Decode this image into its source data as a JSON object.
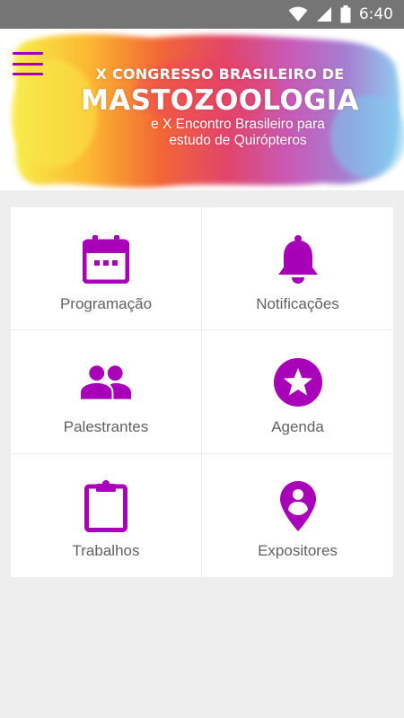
{
  "status_bar": {
    "time": "6:40",
    "icons": [
      "wifi-icon",
      "signal-icon",
      "battery-icon"
    ]
  },
  "banner": {
    "line1": "X CONGRESSO BRASILEIRO DE",
    "line2": "MASTOZOOLOGIA",
    "line3": "e X Encontro Brasileiro para",
    "line4": "estudo de Quirópteros"
  },
  "theme": {
    "accent": "#a800b8",
    "label_color": "#616161",
    "background": "#eeeeee"
  },
  "menu": [
    {
      "label": "Programação",
      "icon": "calendar-icon"
    },
    {
      "label": "Notificações",
      "icon": "bell-icon"
    },
    {
      "label": "Palestrantes",
      "icon": "people-icon"
    },
    {
      "label": "Agenda",
      "icon": "star-icon"
    },
    {
      "label": "Trabalhos",
      "icon": "clipboard-icon"
    },
    {
      "label": "Expositores",
      "icon": "location-pin-icon"
    }
  ]
}
